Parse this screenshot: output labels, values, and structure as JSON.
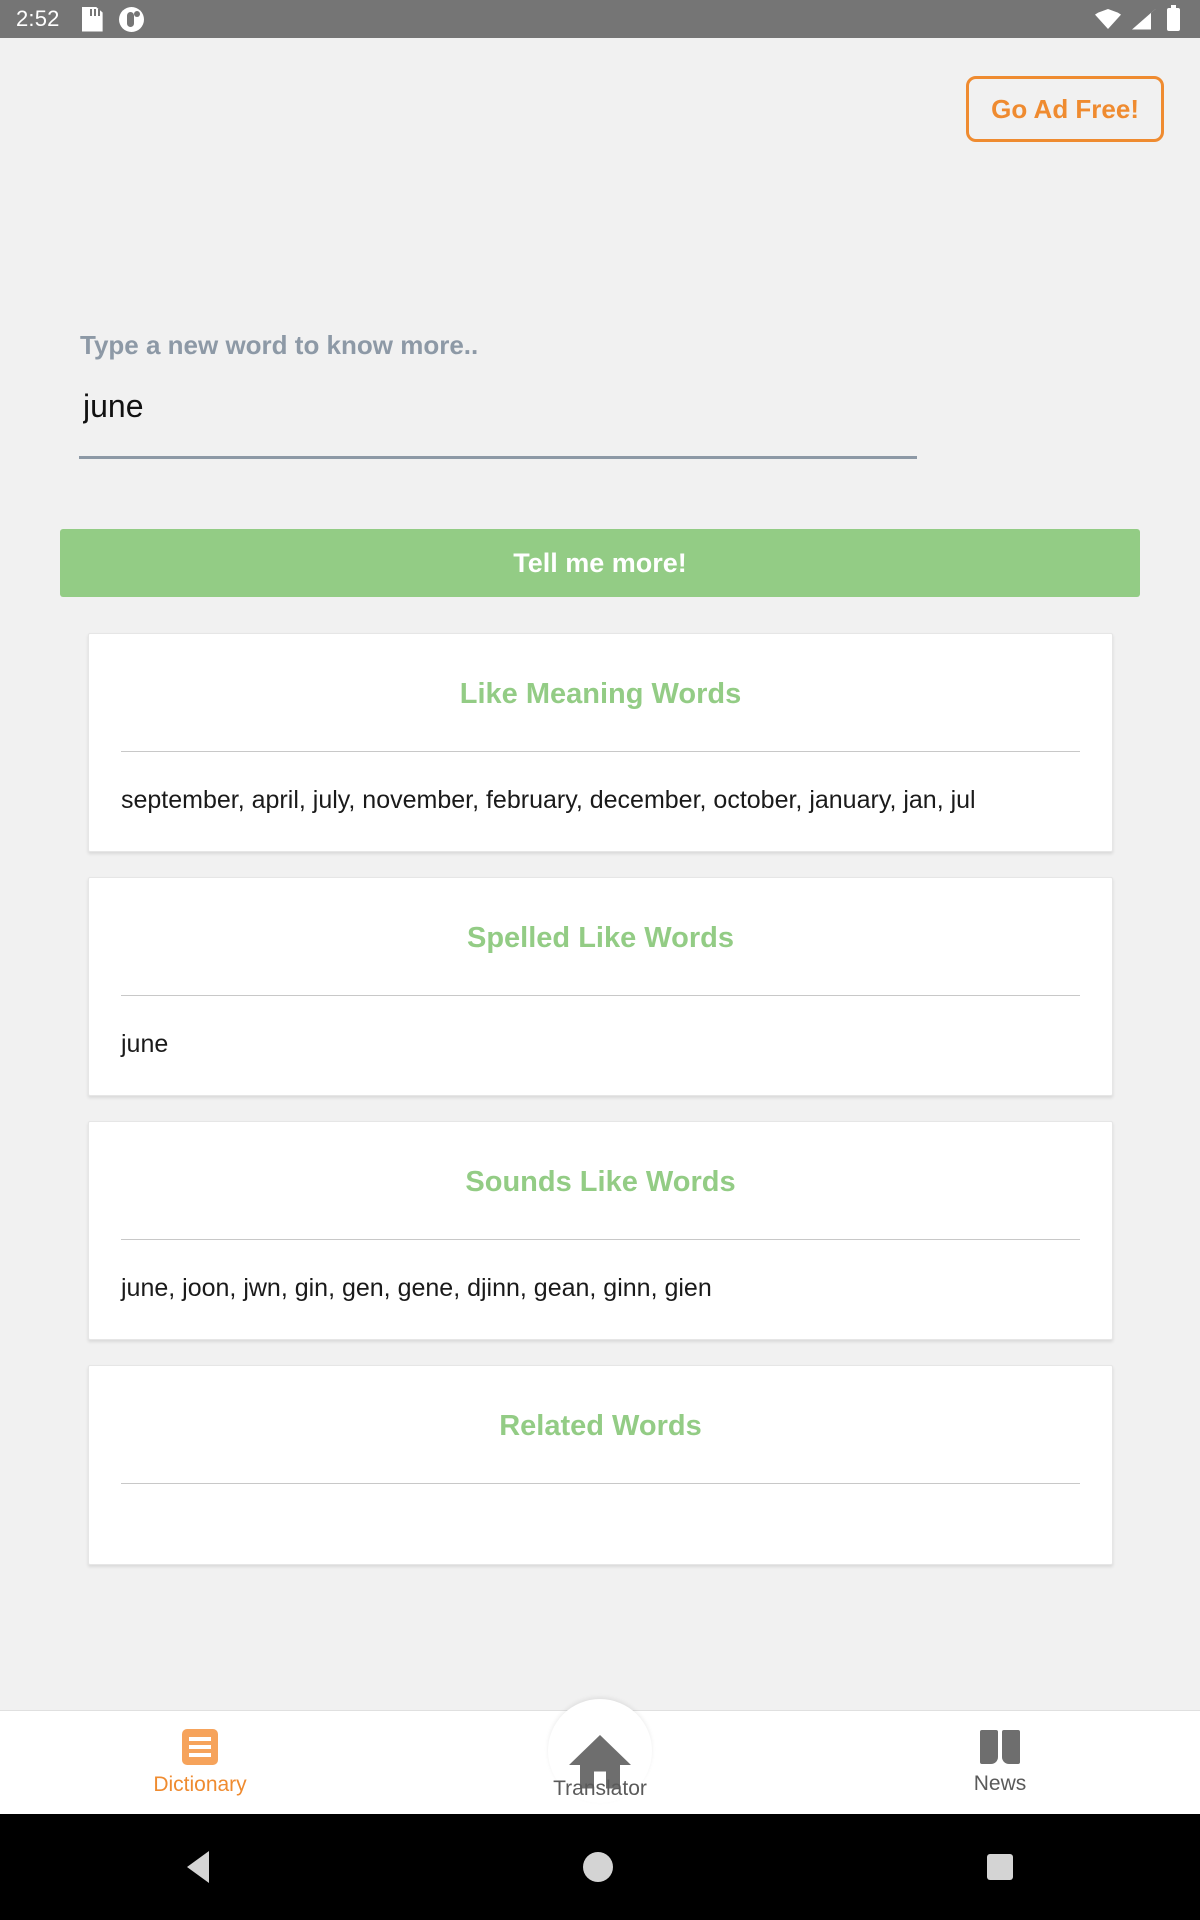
{
  "status_bar": {
    "clock": "2:52",
    "left_icons": [
      "sd-card-icon",
      "app-notification-icon"
    ],
    "right_icons": [
      "wifi-icon",
      "cellular-signal-icon",
      "battery-icon"
    ]
  },
  "header": {
    "ad_free_label": "Go Ad Free!",
    "ad_free_color": "#ef8b30"
  },
  "search": {
    "label": "Type a new word to know more..",
    "value": "june",
    "placeholder": "Type a new word to know more..",
    "submit_label": "Tell me more!",
    "submit_color": "#93cc85"
  },
  "cards": [
    {
      "title": "Like Meaning Words",
      "content": "september, april, july, november, february, december, october, january, jan, jul"
    },
    {
      "title": "Spelled Like Words",
      "content": "june"
    },
    {
      "title": "Sounds Like Words",
      "content": "june, joon, jwn, gin, gen, gene, djinn, gean, ginn, gien"
    },
    {
      "title": "Related Words",
      "content": ""
    }
  ],
  "bottom_nav": {
    "active_color": "#ef8b30",
    "items": [
      {
        "label": "Dictionary",
        "icon": "list-icon",
        "active": true
      },
      {
        "label": "Translator",
        "icon": "home-icon",
        "active": false
      },
      {
        "label": "News",
        "icon": "book-icon",
        "active": false
      }
    ]
  },
  "system_nav": {
    "back": "back-button",
    "home": "home-button",
    "recents": "recents-button"
  }
}
